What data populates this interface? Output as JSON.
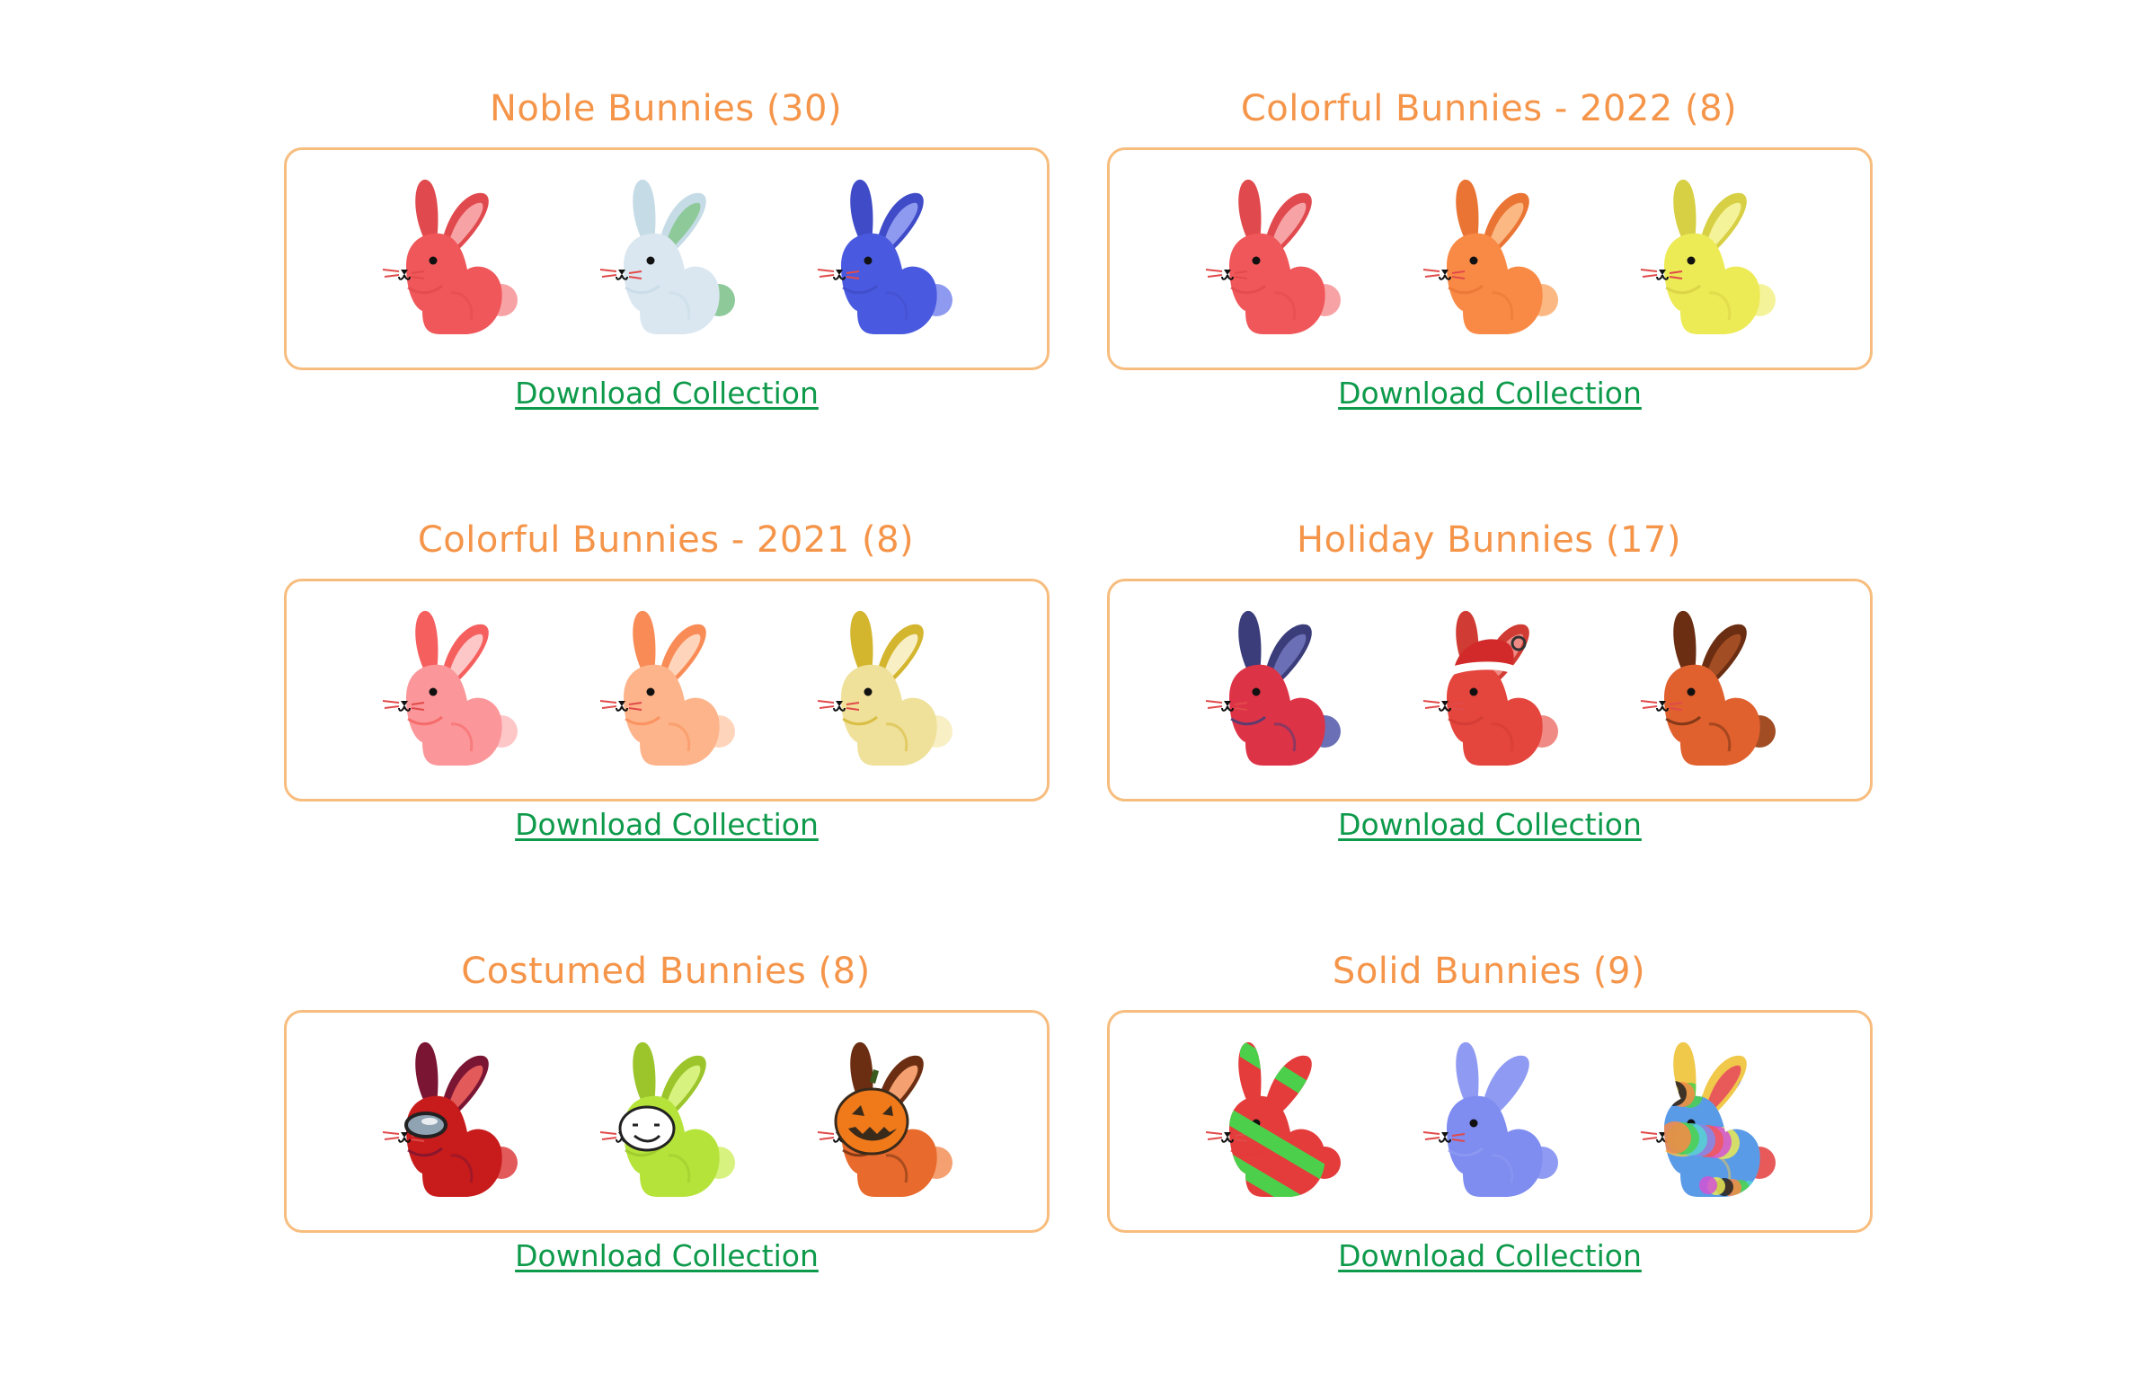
{
  "download_label": "Download Collection",
  "collections": [
    {
      "title": "Noble Bunnies (30)",
      "bunnies": [
        {
          "name": "red-bunny-icon",
          "body": "#f0575a",
          "ear": "#e04a4e",
          "inner": "#f7a3a5"
        },
        {
          "name": "crystal-bunny-icon",
          "body": "#dbe7f0",
          "ear": "#c5dbe6",
          "inner": "#8ec99a",
          "accent": "#3f8f55"
        },
        {
          "name": "blue-bunny-icon",
          "body": "#4a5ae0",
          "ear": "#3f4bc7",
          "inner": "#8e99f0"
        }
      ]
    },
    {
      "title": "Colorful Bunnies - 2022 (8)",
      "bunnies": [
        {
          "name": "red-bunny-icon",
          "body": "#f0575a",
          "ear": "#e04a4e",
          "inner": "#f7a3a5"
        },
        {
          "name": "orange-bunny-icon",
          "body": "#f98a45",
          "ear": "#ea7434",
          "inner": "#fbb882"
        },
        {
          "name": "yellow-bunny-icon",
          "body": "#ecea55",
          "ear": "#d7d044",
          "inner": "#f5f39a"
        }
      ]
    },
    {
      "title": "Colorful Bunnies - 2021 (8)",
      "bunnies": [
        {
          "name": "pink-bunny-icon",
          "body": "#fb979a",
          "ear": "#f5605f",
          "inner": "#fdc7c8"
        },
        {
          "name": "peach-bunny-icon",
          "body": "#fdb48a",
          "ear": "#f98b56",
          "inner": "#fed5bb"
        },
        {
          "name": "cream-bunny-icon",
          "body": "#efe09a",
          "ear": "#d4b52e",
          "inner": "#f8efc4"
        }
      ]
    },
    {
      "title": "Holiday Bunnies (17)",
      "bunnies": [
        {
          "name": "americana-bunny-icon",
          "body": "#dd3347",
          "ear": "#3b3d7a",
          "inner": "#6b6fb5"
        },
        {
          "name": "santa-hat-bunny-icon",
          "body": "#e4453c",
          "ear": "#d03b33",
          "inner": "#f08a84",
          "hat": true
        },
        {
          "name": "chocolate-ear-bunny-icon",
          "body": "#e0602e",
          "ear": "#6b2e12",
          "inner": "#a24d24"
        }
      ]
    },
    {
      "title": "Costumed Bunnies (8)",
      "bunnies": [
        {
          "name": "crewmate-bunny-icon",
          "body": "#c81b1b",
          "ear": "#7a1533",
          "inner": "#e25a5a",
          "visor": true
        },
        {
          "name": "mask-bunny-icon",
          "body": "#b5e33a",
          "ear": "#9cc52b",
          "inner": "#d7f27f",
          "mask": true
        },
        {
          "name": "pumpkin-bunny-icon",
          "body": "#e86a2c",
          "ear": "#6b2e12",
          "inner": "#f4a070",
          "pumpkin": true
        }
      ]
    },
    {
      "title": "Solid Bunnies (9)",
      "bunnies": [
        {
          "name": "striped-bunny-icon",
          "body": "#e43b3b",
          "ear": "#e43b3b",
          "inner": "#e43b3b",
          "stripes": "#4cd04c"
        },
        {
          "name": "periwinkle-bunny-icon",
          "body": "#7f8cf0",
          "ear": "#8f9bf2",
          "inner": "#8f9bf2"
        },
        {
          "name": "collage-bunny-icon",
          "body": "#5a9be8",
          "ear": "#f0c84a",
          "inner": "#e85a5a",
          "collage": true
        }
      ]
    }
  ]
}
